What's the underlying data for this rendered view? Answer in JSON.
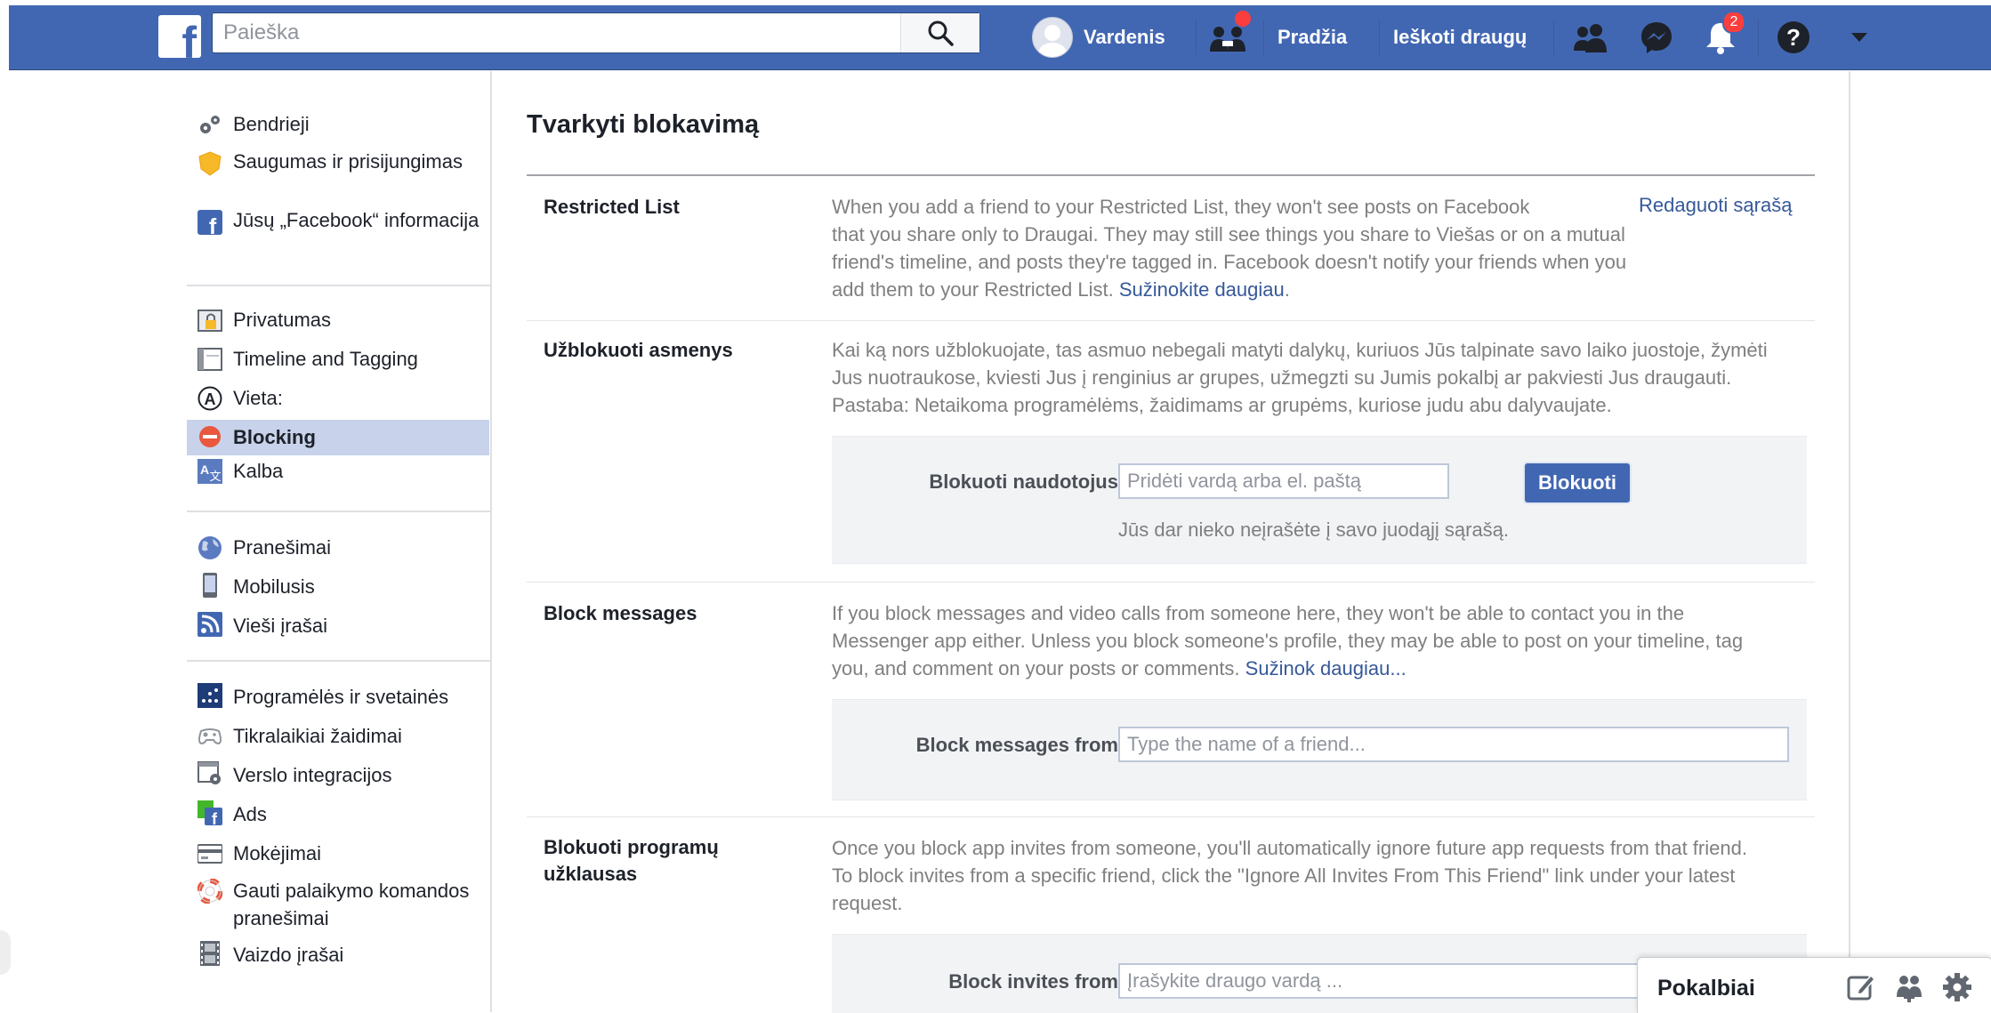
{
  "topbar": {
    "logo": "f",
    "search_placeholder": "Paieška",
    "user_name": "Vardenis",
    "home": "Pradžia",
    "find_friends": "Ieškoti draugų",
    "notifications_count": "2",
    "icons": [
      "friend-requests-icon",
      "messenger-icon",
      "notifications-icon",
      "help-icon",
      "dropdown-arrow-icon"
    ]
  },
  "sidebar": {
    "groups": [
      [
        {
          "label": "Bendrieji",
          "icon": "gears-icon"
        },
        {
          "label": "Saugumas ir prisijungimas",
          "icon": "security-badge-icon"
        },
        {
          "label": "Jūsų „Facebook“ informacija",
          "icon": "facebook-icon"
        }
      ],
      [
        {
          "label": "Privatumas",
          "icon": "privacy-lock-icon"
        },
        {
          "label": "Timeline and Tagging",
          "icon": "timeline-icon"
        },
        {
          "label": "Vieta:",
          "icon": "location-icon"
        },
        {
          "label": "Blocking",
          "icon": "blocking-icon",
          "active": true
        },
        {
          "label": "Kalba",
          "icon": "language-icon"
        }
      ],
      [
        {
          "label": "Pranešimai",
          "icon": "globe-icon"
        },
        {
          "label": "Mobilusis",
          "icon": "mobile-icon"
        },
        {
          "label": "Vieši įrašai",
          "icon": "rss-icon"
        }
      ],
      [
        {
          "label": "Programėlės ir svetainės",
          "icon": "apps-icon"
        },
        {
          "label": "Tikralaikiai žaidimai",
          "icon": "gamepad-icon"
        },
        {
          "label": "Verslo integracijos",
          "icon": "business-integration-icon"
        },
        {
          "label": "Ads",
          "icon": "ads-icon"
        },
        {
          "label": "Mokėjimai",
          "icon": "payment-card-icon"
        },
        {
          "label": "Gauti palaikymo komandos pranešimai",
          "icon": "lifebuoy-icon"
        },
        {
          "label": "Vaizdo įrašai",
          "icon": "film-icon"
        }
      ]
    ]
  },
  "main": {
    "title": "Tvarkyti blokavimą",
    "restricted": {
      "title": "Restricted List",
      "edit_link": "Redaguoti sąrašą",
      "desc_lines": [
        "When you add a friend to your Restricted List, they won't see posts on Facebook",
        "that you share only to Draugai. They may still see things you share to Viešas or on a mutual",
        "friend's timeline, and posts they're tagged in. Facebook doesn't notify your friends when you",
        "add them to your Restricted List."
      ],
      "learn_more": "Sužinokite daugiau"
    },
    "block_users": {
      "title": "Užblokuoti asmenys",
      "desc_lines": [
        "Kai ką nors užblokuojate, tas asmuo nebegali matyti dalykų, kuriuos Jūs talpinate savo laiko juostoje, žymėti",
        "Jus nuotraukose, kviesti Jus į renginius ar grupes, užmegzti su Jumis pokalbį ar pakviesti Jus draugauti.",
        "Pastaba: Netaikoma programėlėms, žaidimams ar grupėms, kuriose judu abu dalyvaujate."
      ],
      "field_label": "Blokuoti naudotojus",
      "placeholder": "Pridėti vardą arba el. paštą",
      "button": "Blokuoti",
      "empty_note": "Jūs dar nieko neįrašėte į savo juodąjį sąrašą."
    },
    "block_messages": {
      "title": "Block messages",
      "desc_lines": [
        "If you block messages and video calls from someone here, they won't be able to contact you in the",
        "Messenger app either. Unless you block someone's profile, they may be able to post on your timeline, tag",
        "you, and comment on your posts or comments."
      ],
      "learn_more": "Sužinok daugiau...",
      "field_label": "Block messages from",
      "placeholder": "Type the name of a friend..."
    },
    "block_app_invites": {
      "title_lines": [
        "Blokuoti programų",
        "užklausas"
      ],
      "desc_lines": [
        "Once you block app invites from someone, you'll automatically ignore future app requests from that friend.",
        "To block invites from a specific friend, click the \"Ignore All Invites From This Friend\" link under your latest",
        "request."
      ],
      "field_label": "Block invites from",
      "placeholder": "Įrašykite draugo vardą ..."
    }
  },
  "chat": {
    "title": "Pokalbiai",
    "icons": [
      "new-message-icon",
      "create-group-icon",
      "chat-settings-icon"
    ]
  },
  "colors": {
    "brand_blue": "#4267b2",
    "link_blue": "#365899",
    "active_item_bg": "#c8d3eb",
    "badge_red": "#fa3e3e"
  }
}
